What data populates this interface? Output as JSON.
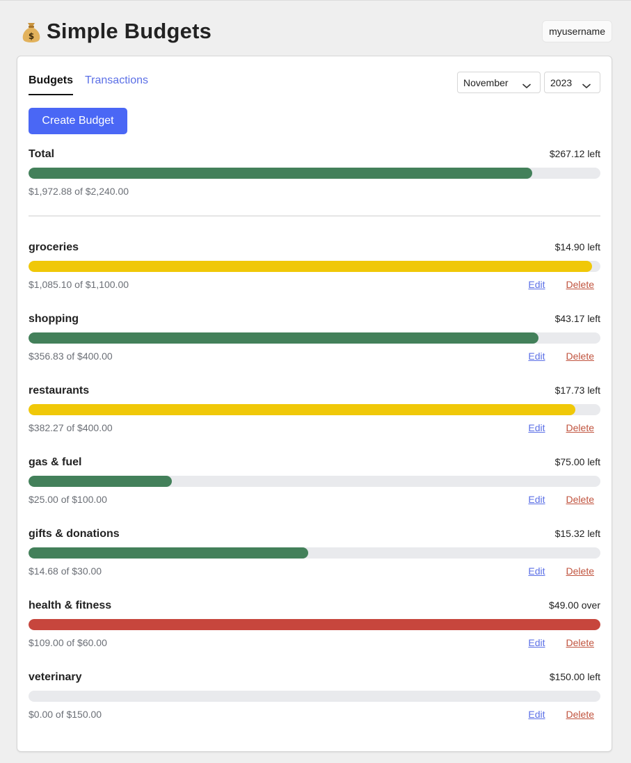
{
  "app": {
    "title": "Simple Budgets",
    "logo_icon": "money-bag-icon",
    "username": "myusername"
  },
  "tabs": [
    {
      "label": "Budgets",
      "active": true
    },
    {
      "label": "Transactions",
      "active": false
    }
  ],
  "filters": {
    "month": "November",
    "year": "2023"
  },
  "create_button": "Create Budget",
  "total": {
    "name": "Total",
    "status": "$267.12 left",
    "spent_text": "$1,972.88 of $2,240.00",
    "progress": 0.881,
    "color": "#43805a"
  },
  "actions": {
    "edit": "Edit",
    "delete": "Delete"
  },
  "budgets": [
    {
      "name": "groceries",
      "status": "$14.90 left",
      "spent_text": "$1,085.10 of $1,100.00",
      "progress": 0.986,
      "color": "#f0c808"
    },
    {
      "name": "shopping",
      "status": "$43.17 left",
      "spent_text": "$356.83 of $400.00",
      "progress": 0.892,
      "color": "#43805a"
    },
    {
      "name": "restaurants",
      "status": "$17.73 left",
      "spent_text": "$382.27 of $400.00",
      "progress": 0.956,
      "color": "#f0c808"
    },
    {
      "name": "gas & fuel",
      "status": "$75.00 left",
      "spent_text": "$25.00 of $100.00",
      "progress": 0.25,
      "color": "#43805a"
    },
    {
      "name": "gifts & donations",
      "status": "$15.32 left",
      "spent_text": "$14.68 of $30.00",
      "progress": 0.489,
      "color": "#43805a"
    },
    {
      "name": "health & fitness",
      "status": "$49.00 over",
      "spent_text": "$109.00 of $60.00",
      "progress": 1.0,
      "color": "#c7463d"
    },
    {
      "name": "veterinary",
      "status": "$150.00 left",
      "spent_text": "$0.00 of $150.00",
      "progress": 0.0,
      "color": "#43805a"
    }
  ],
  "colors": {
    "accent": "#4a67f5",
    "link": "#5b6fe6",
    "danger_link": "#c0533e",
    "track": "#e9eaed"
  }
}
